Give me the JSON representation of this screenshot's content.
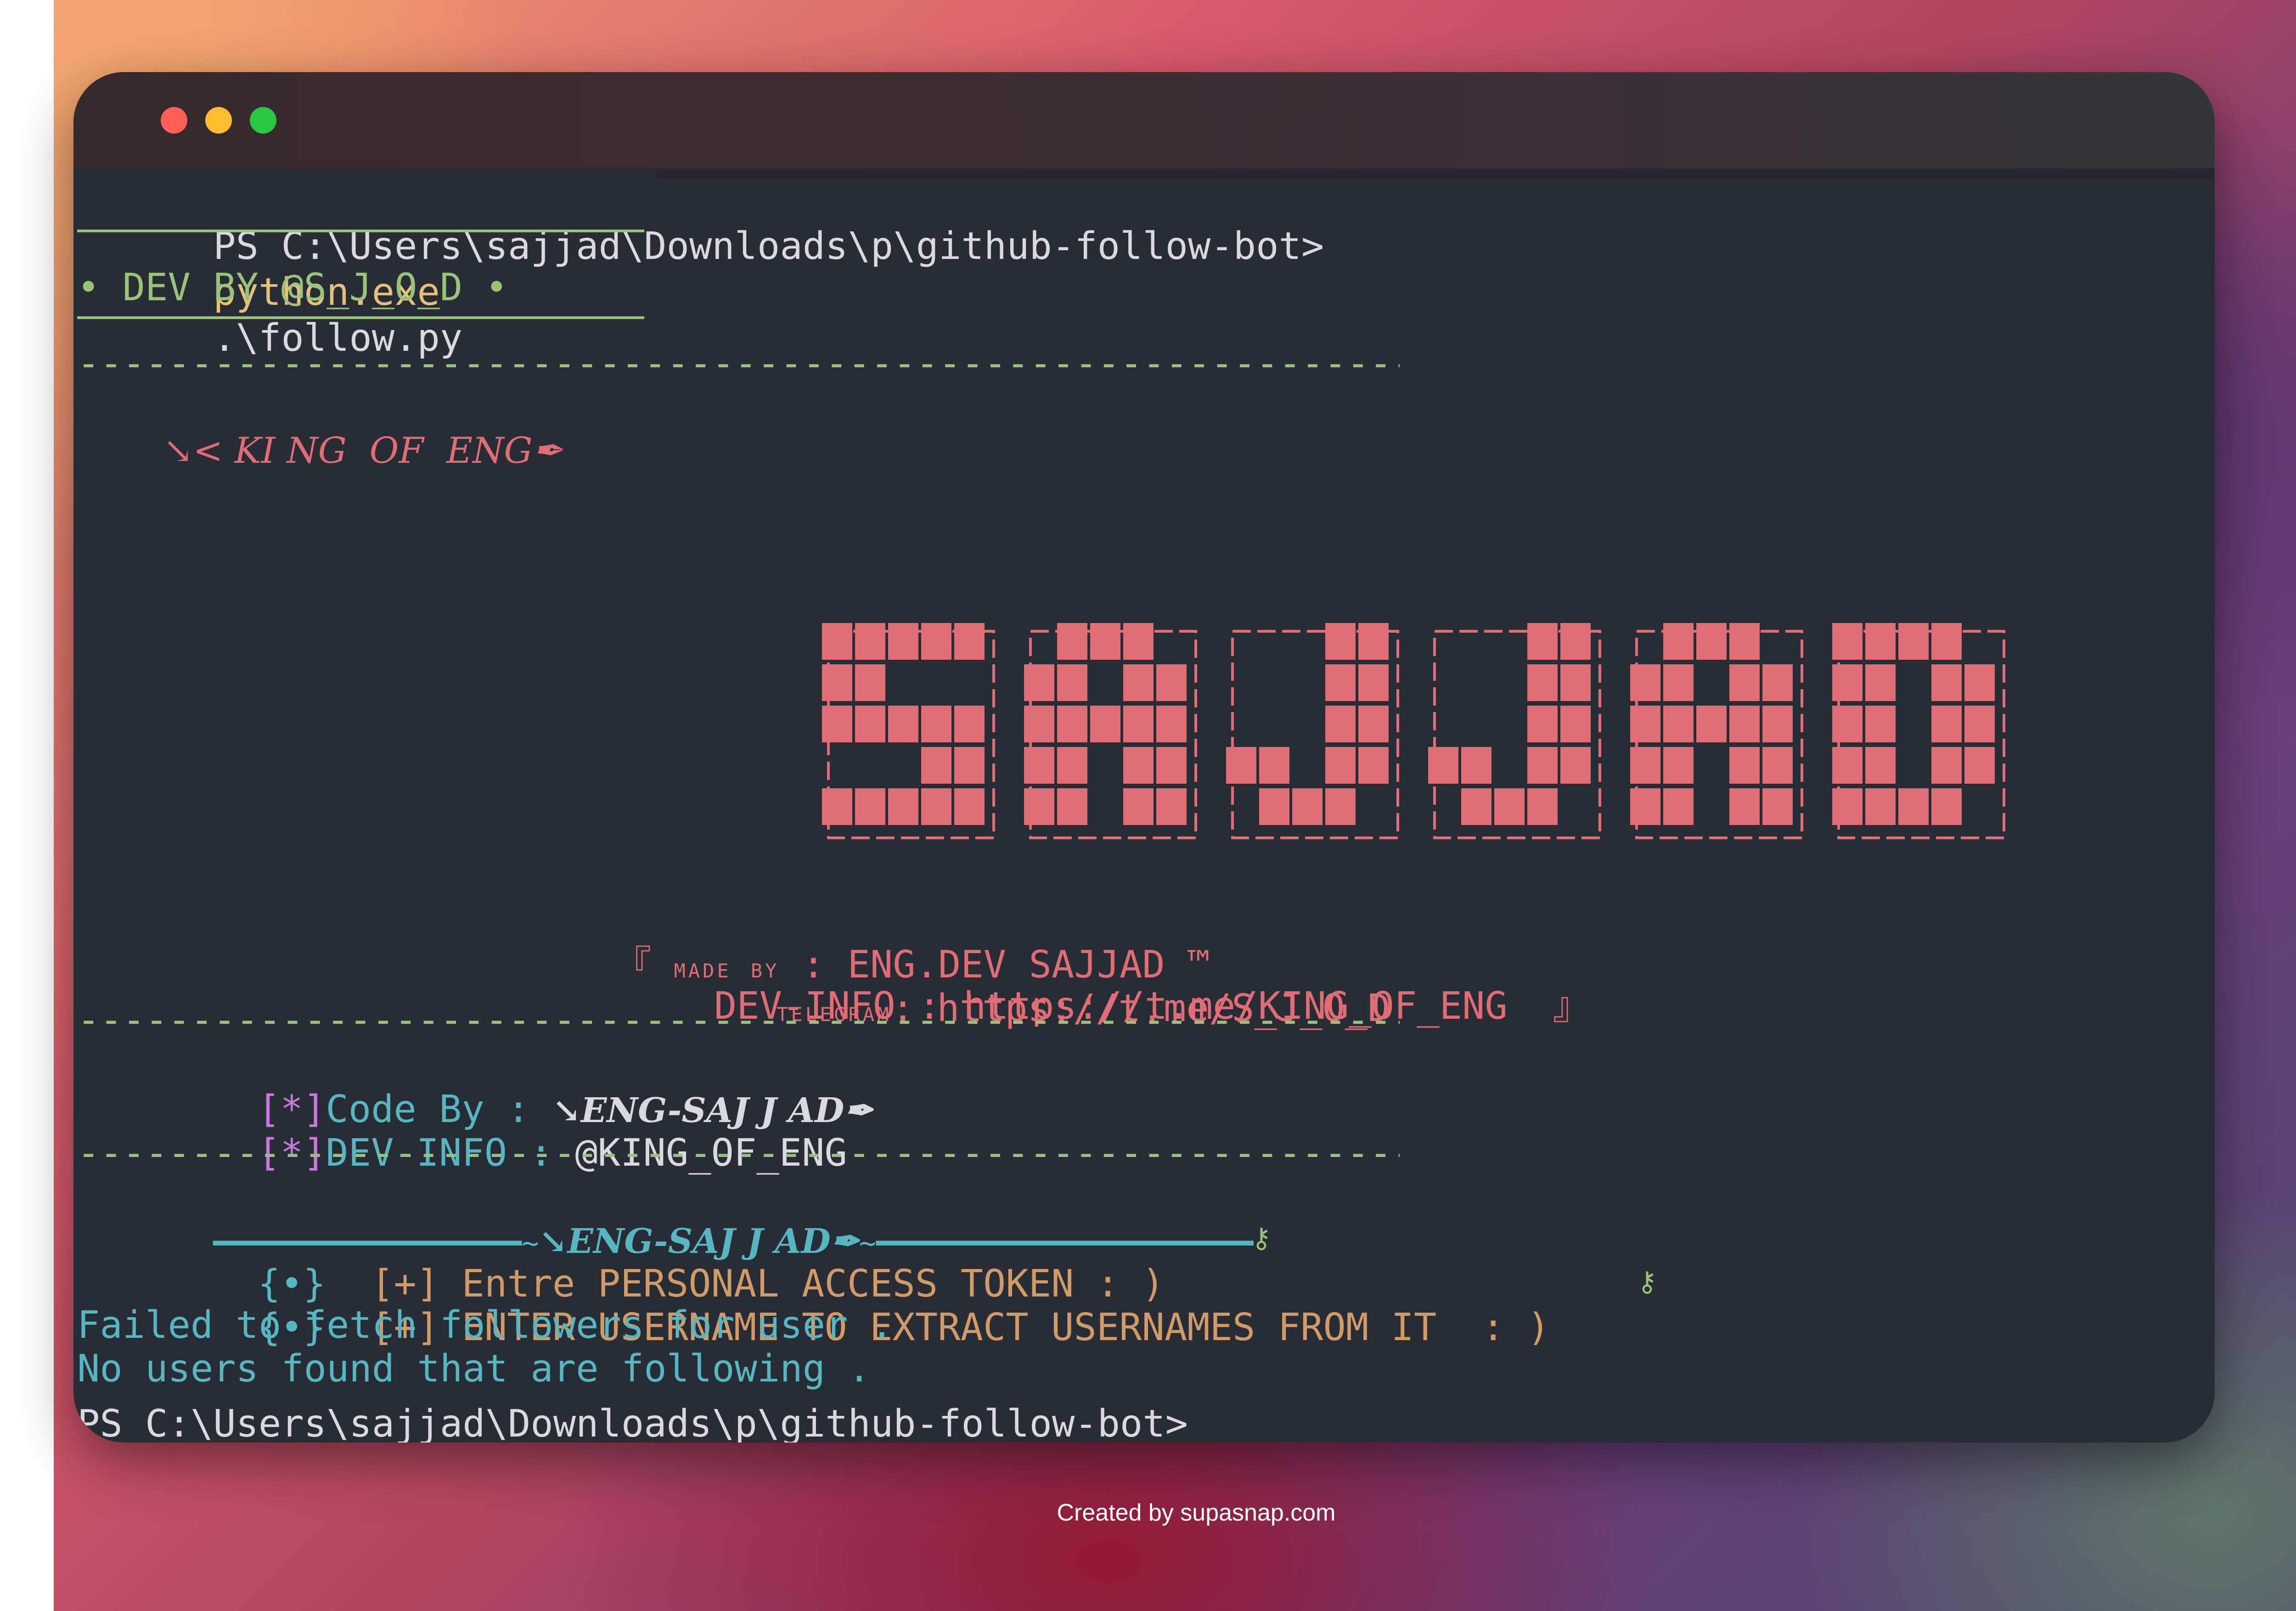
{
  "terminal": {
    "prompt": "PS C:\\Users\\sajjad\\Downloads\\p\\github-follow-bot>",
    "command": "python.exe",
    "argument": ".\\follow.py",
    "dev_by": "• DEV BY @S_J_O_D •",
    "dash_line": "------------------------------------------------------------",
    "king_line": "↘< KI NG  OF  ENG✒",
    "banner_text": "SAJJAD",
    "made_by_prefix": "『 ",
    "made_by_label": "made by",
    "made_by_value": " : ENG.DEV SAJJAD ™",
    "telegram_label": "telegram",
    "telegram_value": ": https://t.me/S_J_O_D",
    "devinfo_line": "DEV-INFO : https://t.me/KING_OF_ENG  』",
    "code_by_bracket": "[*]",
    "code_by_label": "Code By : ",
    "code_by_value": "↘ENG-SAJ J AD✒",
    "devinfo2_bracket": "[*]",
    "devinfo2_label": "DEV-INFO : ",
    "devinfo2_value": "@KING_OF_ENG",
    "sep_left": "━━━━━━━━━━━━━━━━━━~",
    "sep_mid": "↘ENG-SAJ J AD✒",
    "sep_right": "~━━━━━━━━━━━━━━━━━━━━━━",
    "input1_bullet": "{•}",
    "input1_text": "  [+] Entre PERSONAL ACCESS TOKEN : )",
    "input1_key": "⚷",
    "input2_bullet": "{•}",
    "input2_text": "  [+] ENTER USERNAME TO EXTRACT USERNAMES FROM IT  : )",
    "input2_key": "⚷",
    "error1": "Failed to fetch followers for user .",
    "error2": "No users found that are following .",
    "next_prompt": "PS C:\\Users\\sajjad\\Downloads\\p\\github-follow-bot>"
  },
  "footer": {
    "credit": "Created by supasnap.com"
  },
  "colors": {
    "background": "#282c34",
    "accent_red": "#e06c75",
    "accent_green": "#98c379",
    "accent_cyan": "#56b6c2",
    "accent_yellow": "#e5c07b"
  }
}
